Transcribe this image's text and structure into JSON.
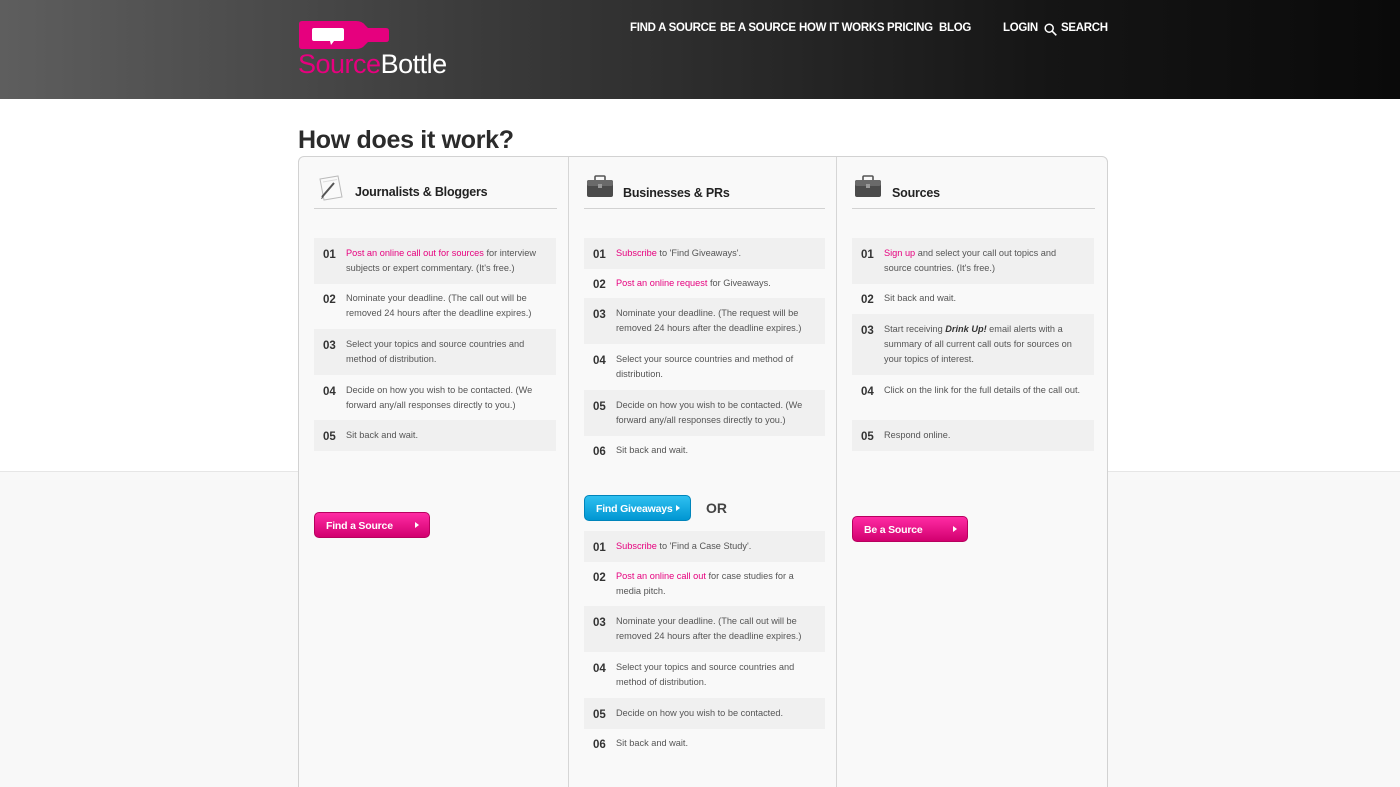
{
  "logo": {
    "part1": "Source",
    "part2": "Bottle"
  },
  "nav": {
    "find_source": "FIND A SOURCE",
    "be_source": "BE A SOURCE",
    "how_it_works": "HOW IT WORKS",
    "pricing": "PRICING",
    "blog": "BLOG",
    "login": "LOGIN",
    "search": "SEARCH"
  },
  "page_title": "How does it work?",
  "journalists": {
    "title": "Journalists & Bloggers",
    "steps": [
      {
        "num": "01",
        "link": "Post an online call out for sources",
        "text": " for interview subjects or expert commentary. (It's free.)"
      },
      {
        "num": "02",
        "text": "Nominate your deadline. (The call out will be removed 24 hours after the deadline expires.)"
      },
      {
        "num": "03",
        "text": "Select your topics and source countries and method of distribution."
      },
      {
        "num": "04",
        "text": "Decide on how you wish to be contacted. (We forward any/all responses directly to you.)"
      },
      {
        "num": "05",
        "text": "Sit back and wait."
      }
    ],
    "button": "Find a Source"
  },
  "businesses": {
    "title": "Businesses & PRs",
    "steps": [
      {
        "num": "01",
        "link": "Subscribe",
        "text": " to 'Find Giveaways'."
      },
      {
        "num": "02",
        "link": "Post an online request",
        "text": " for Giveaways."
      },
      {
        "num": "03",
        "text": "Nominate your deadline. (The request will be removed 24 hours after the deadline expires.)"
      },
      {
        "num": "04",
        "text": "Select your source countries and method of distribution."
      },
      {
        "num": "05",
        "text": "Decide on how you wish to be contacted. (We forward any/all responses directly to you.)"
      },
      {
        "num": "06",
        "text": "Sit back and wait."
      }
    ],
    "button": "Find Giveaways",
    "or": "OR",
    "steps2": [
      {
        "num": "01",
        "link": "Subscribe",
        "text": " to 'Find a Case Study'."
      },
      {
        "num": "02",
        "link": "Post an online call out",
        "text": " for case studies for a media pitch."
      },
      {
        "num": "03",
        "text": "Nominate your deadline. (The call out will be removed 24 hours after the deadline expires.)"
      },
      {
        "num": "04",
        "text": "Select your topics and source countries and method of distribution."
      },
      {
        "num": "05",
        "text": "Decide on how you wish to be contacted."
      },
      {
        "num": "06",
        "text": "Sit back and wait."
      }
    ]
  },
  "sources": {
    "title": "Sources",
    "steps": [
      {
        "num": "01",
        "link": "Sign up",
        "text": " and select your call out topics and source countries. (It's free.)"
      },
      {
        "num": "02",
        "text": "Sit back and wait."
      },
      {
        "num": "03",
        "pre": "Start receiving ",
        "em": "Drink Up!",
        "text": " email alerts with a summary of all current call outs for sources on your topics of interest."
      },
      {
        "num": "04",
        "text": "Click on the link for the full details of the call out."
      },
      {
        "num": "05",
        "text": "Respond online."
      }
    ],
    "button": "Be a Source"
  },
  "colors": {
    "accent": "#e6007e",
    "blue_button": "#1aa6e0"
  },
  "icons": {
    "journalists": "notepad-pencil-icon",
    "businesses": "briefcase-icon",
    "sources": "briefcase-icon",
    "search": "search-icon",
    "logo": "bottle-speech-bubble-icon"
  }
}
